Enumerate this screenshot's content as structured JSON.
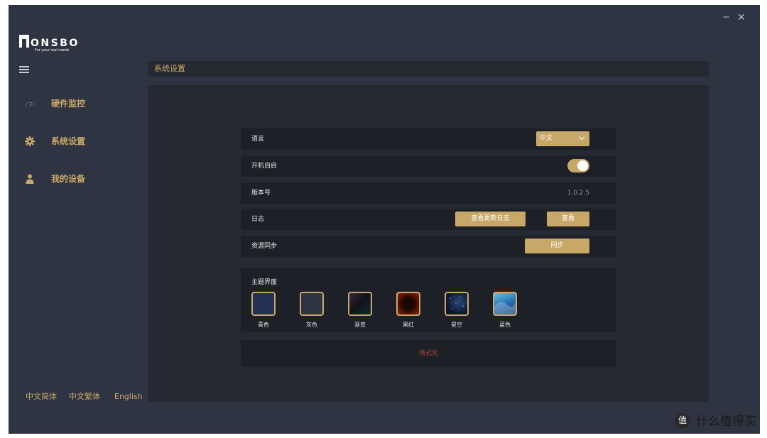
{
  "window": {
    "minimize_glyph": "−",
    "close_glyph": "✕"
  },
  "brand": {
    "logo_text": "ONSBO",
    "tagline": "For your real needs"
  },
  "sidebar": {
    "items": [
      {
        "label": "硬件监控",
        "icon": "speedometer-icon"
      },
      {
        "label": "系统设置",
        "icon": "gear-icon"
      },
      {
        "label": "我的设备",
        "icon": "user-icon"
      }
    ],
    "languages": [
      "中文简体",
      "中文繁体",
      "English"
    ]
  },
  "header": {
    "title": "系统设置"
  },
  "settings": {
    "language": {
      "label": "语言",
      "value": "中文"
    },
    "autostart": {
      "label": "开机自启",
      "enabled": true
    },
    "version": {
      "label": "版本号",
      "value": "1.0.2.5"
    },
    "log": {
      "label": "日志",
      "changelog_button": "查看更新日志",
      "view_button": "查看"
    },
    "sync": {
      "label": "资源同步",
      "button": "同步"
    },
    "theme": {
      "label": "主题界面",
      "options": [
        {
          "name": "青色"
        },
        {
          "name": "灰色"
        },
        {
          "name": "渐变"
        },
        {
          "name": "黑红"
        },
        {
          "name": "星空"
        },
        {
          "name": "蓝色"
        }
      ]
    },
    "format_label": "格式化"
  },
  "colors": {
    "accent": "#c8a869",
    "background": "#2f3442",
    "panel": "#252932",
    "row": "#1d2027",
    "danger": "#b0413e"
  },
  "watermark": {
    "text": "什么值得买"
  }
}
